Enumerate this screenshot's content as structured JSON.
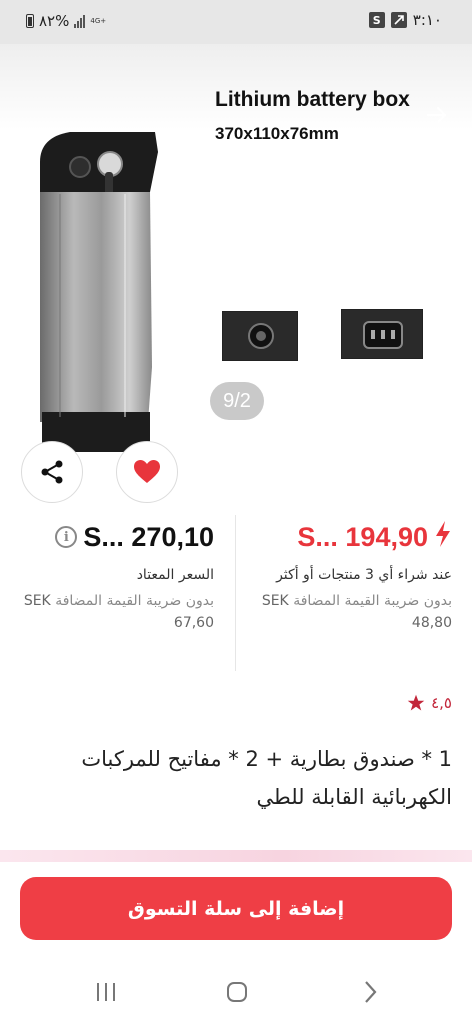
{
  "status_bar": {
    "battery_percent": "٨٢%",
    "network": "4G+",
    "time": "٣:١٠",
    "icons": [
      "battery-icon",
      "signal-icon",
      "s-app-icon",
      "notification-icon"
    ]
  },
  "product": {
    "title": "Lithium battery box",
    "dimensions": "370x110x76mm",
    "image_counter": "9/2"
  },
  "actions": {
    "share_icon": "share-icon",
    "favorite_icon": "heart-icon"
  },
  "pricing": {
    "regular": {
      "price": "S... 270,10",
      "label": "السعر المعتاد",
      "tax_note": "بدون ضريبة القيمة المضافة",
      "tax_amount": "SEK 67,60"
    },
    "bulk": {
      "price": "S... 194,90",
      "label": "عند شراء أي 3 منتجات أو أكثر",
      "tax_note": "بدون ضريبة القيمة المضافة",
      "tax_amount": "SEK 48,80"
    }
  },
  "rating": {
    "value": "٤,٥"
  },
  "description": "1 * صندوق بطارية + 2 * مفاتيح للمركبات الكهربائية القابلة للطي",
  "cart_button": {
    "label": "إضافة إلى سلة التسوق"
  },
  "colors": {
    "accent": "#ef3e45",
    "price_red": "#e8353c",
    "rating_red": "#c2263a"
  }
}
